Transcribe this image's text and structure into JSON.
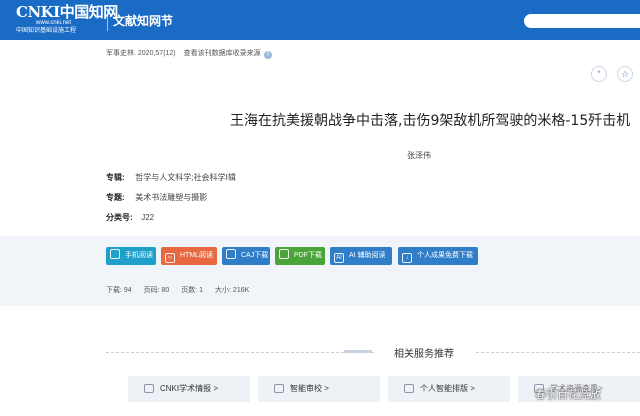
{
  "header": {
    "logo_top": "CNKI中国知网",
    "logo_url": "www.cnki.net",
    "logo_bottom": "中国知识基础设施工程",
    "site_title": "文献知网节"
  },
  "source": {
    "journal": "军事史林",
    "issue": ". 2020,57(12)",
    "catalog_link": "查看该刊数据库收录来源"
  },
  "title": "王海在抗美援朝战争中击落,击伤9架敌机所驾驶的米格-15歼击机",
  "author": "张泽伟",
  "meta": {
    "zhuanji_label": "专辑:",
    "zhuanji_value": "哲学与人文科学;社会科学Ⅰ辑",
    "zhuanti_label": "专题:",
    "zhuanti_value": "美术书法雕塑与摄影",
    "fenlei_label": "分类号:",
    "fenlei_value": "J22"
  },
  "buttons": [
    {
      "label": "手机阅读",
      "color": "#1fa0c8"
    },
    {
      "label": "HTML阅读",
      "color": "#e8693f"
    },
    {
      "label": "CAJ下载",
      "color": "#2f7ec7"
    },
    {
      "label": "PDF下载",
      "color": "#4aa43a"
    },
    {
      "label": "AI 辅助阅读",
      "color": "#2f7ec7"
    },
    {
      "label": "个人成果免费下载",
      "color": "#2f7ec7"
    }
  ],
  "stats": {
    "downloads": "下载: 94",
    "page_no": "页码: 80",
    "page_count": "页数: 1",
    "size": "大小: 216K"
  },
  "recommend": {
    "title": "相关服务推荐",
    "items": [
      "CNKI学术情报 >",
      "智能审校 >",
      "个人智能排版 >",
      "学术资源查重>"
    ]
  },
  "watermark": "春引百花竞放"
}
